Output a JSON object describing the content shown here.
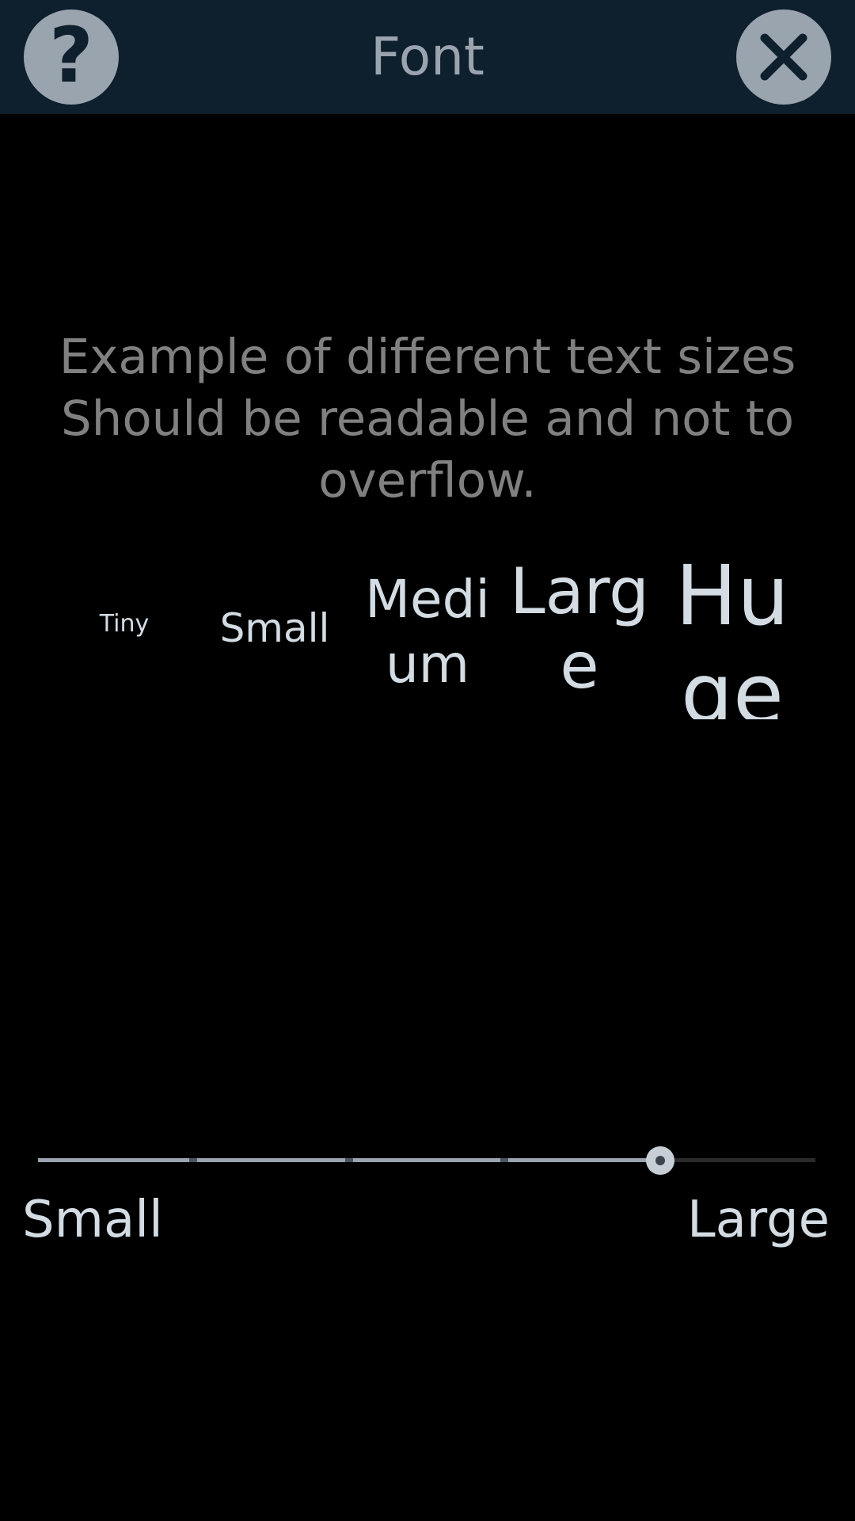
{
  "header": {
    "title": "Font",
    "help_icon": "question-mark-icon",
    "help_glyph": "?",
    "close_icon": "close-icon"
  },
  "example": {
    "line1": "Example of different text sizes",
    "line2": "Should be readable and not to",
    "line3": "overflow."
  },
  "sizes": {
    "tiny": "Tiny",
    "small": "Small",
    "medium": "Medium",
    "large": "Large",
    "huge": "Huge"
  },
  "slider": {
    "min_label": "Small",
    "max_label": "Large",
    "steps": 6,
    "selected_index": 4,
    "value_fraction": 0.8
  },
  "colors": {
    "topbar": "#0e1f2d",
    "icon_circle": "#9aa4ae",
    "text": "#d3dbe3",
    "example_text": "#808080"
  }
}
